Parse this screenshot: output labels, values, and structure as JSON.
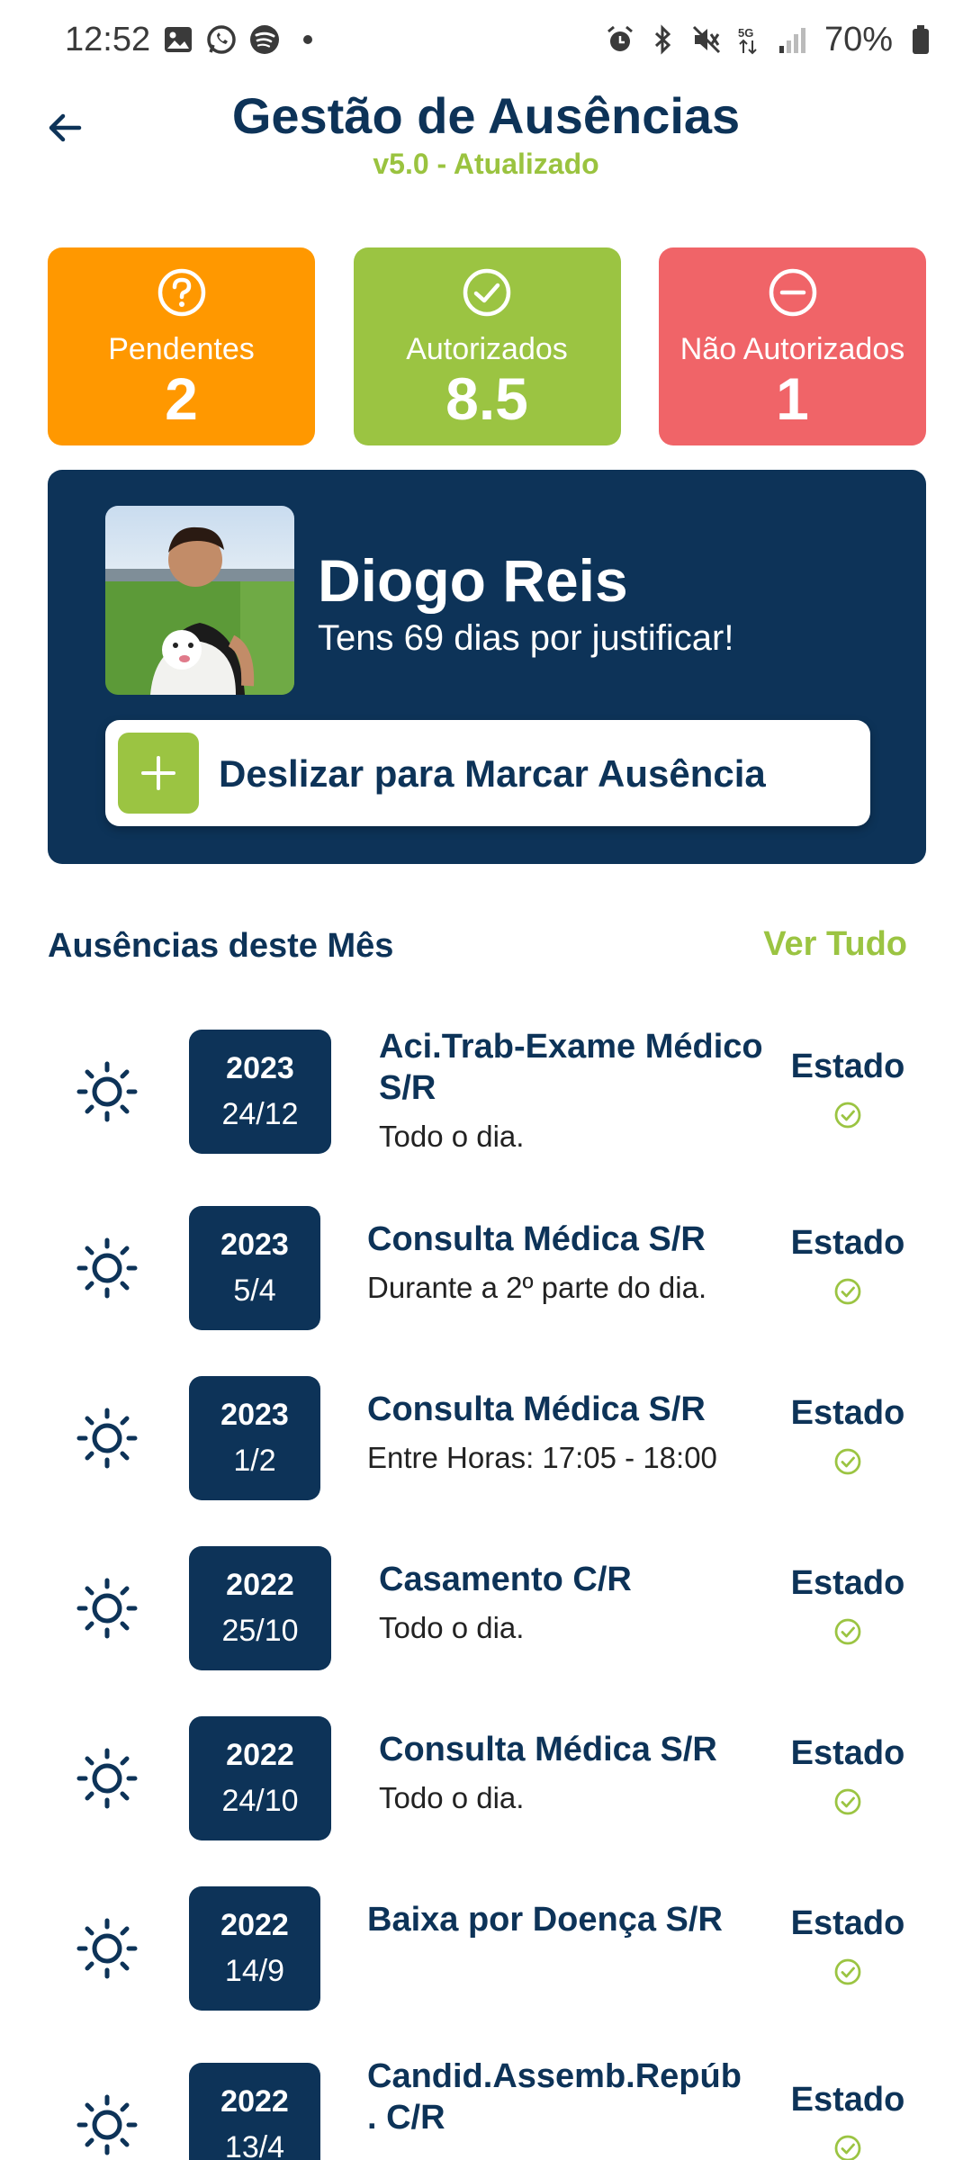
{
  "status_bar": {
    "time": "12:52",
    "battery": "70%"
  },
  "header": {
    "title": "Gestão de Ausências",
    "subtitle": "v5.0 - Atualizado"
  },
  "summary": {
    "pending_label": "Pendentes",
    "pending_value": "2",
    "authorized_label": "Autorizados",
    "authorized_value": "8.5",
    "not_authorized_label": "Não Autorizados",
    "not_authorized_value": "1"
  },
  "profile": {
    "name": "Diogo Reis",
    "message": "Tens 69 dias por justificar!",
    "swipe_label": "Deslizar para Marcar Ausência"
  },
  "section": {
    "title": "Ausências deste Mês",
    "see_all": "Ver Tudo"
  },
  "absences": [
    {
      "year": "2023",
      "date": "24/12",
      "title": "Aci.Trab-Exame Médico S/R",
      "detail": "Todo o dia.",
      "state": "Estado"
    },
    {
      "year": "2023",
      "date": "5/4",
      "title": "Consulta Médica S/R",
      "detail": "Durante a 2º parte do dia.",
      "state": "Estado"
    },
    {
      "year": "2023",
      "date": "1/2",
      "title": "Consulta Médica S/R",
      "detail": "Entre Horas: 17:05 - 18:00",
      "state": "Estado"
    },
    {
      "year": "2022",
      "date": "25/10",
      "title": "Casamento C/R",
      "detail": "Todo o dia.",
      "state": "Estado"
    },
    {
      "year": "2022",
      "date": "24/10",
      "title": "Consulta Médica S/R",
      "detail": "Todo o dia.",
      "state": "Estado"
    },
    {
      "year": "2022",
      "date": "14/9",
      "title": "Baixa por Doença S/R",
      "detail": "",
      "state": "Estado"
    },
    {
      "year": "2022",
      "date": "13/4",
      "title": "Candid.Assemb.Repúb . C/R",
      "detail": "",
      "state": "Estado"
    }
  ],
  "colors": {
    "navy": "#0d3358",
    "green": "#9bc442",
    "orange": "#ff9800",
    "red": "#f06468"
  },
  "icons": {
    "row": "sun-icon",
    "state": "check-circle-icon"
  }
}
